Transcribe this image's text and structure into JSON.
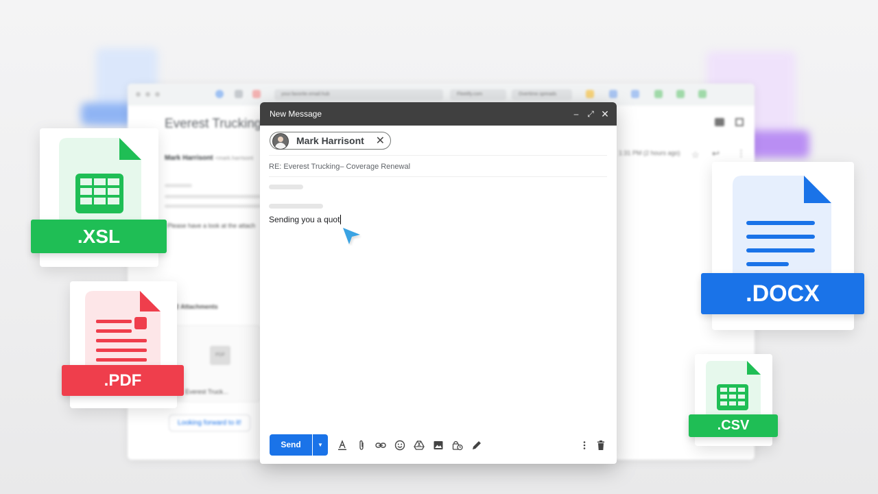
{
  "background_window": {
    "tabs": [
      "your.favorite.email.hub",
      "Fleetify.com",
      "Overtime.spreads"
    ],
    "subject": "Everest Trucking -",
    "sender_name": "Mark Harrisont",
    "sender_email": "<mark.harrisont",
    "time": "1:31 PM (2 hours ago)",
    "snippet": "Please have a look at the attach",
    "attachments_label": "2 Attachments",
    "attachment_name": "Everest Truck...",
    "reply_chip": "Looking forward to it!",
    "pdf_thumb": "PDF"
  },
  "compose": {
    "title": "New Message",
    "recipient": "Mark Harrisont",
    "subject": "RE: Everest Trucking– Coverage Renewal",
    "body": "Sending you a quot",
    "send_label": "Send",
    "icons": [
      "minimize-icon",
      "expand-icon",
      "close-icon",
      "format-text-icon",
      "attach-icon",
      "link-icon",
      "emoji-icon",
      "drive-icon",
      "image-icon",
      "lock-clock-icon",
      "pen-icon",
      "more-vert-icon",
      "trash-icon"
    ]
  },
  "files": {
    "xsl": ".XSL",
    "pdf": ".PDF",
    "docx": ".DOCX",
    "csv": ".CSV"
  },
  "colors": {
    "green": "#1fbe55",
    "red": "#ef3e4c",
    "blue": "#1a73e8",
    "compose_header": "#404040"
  }
}
